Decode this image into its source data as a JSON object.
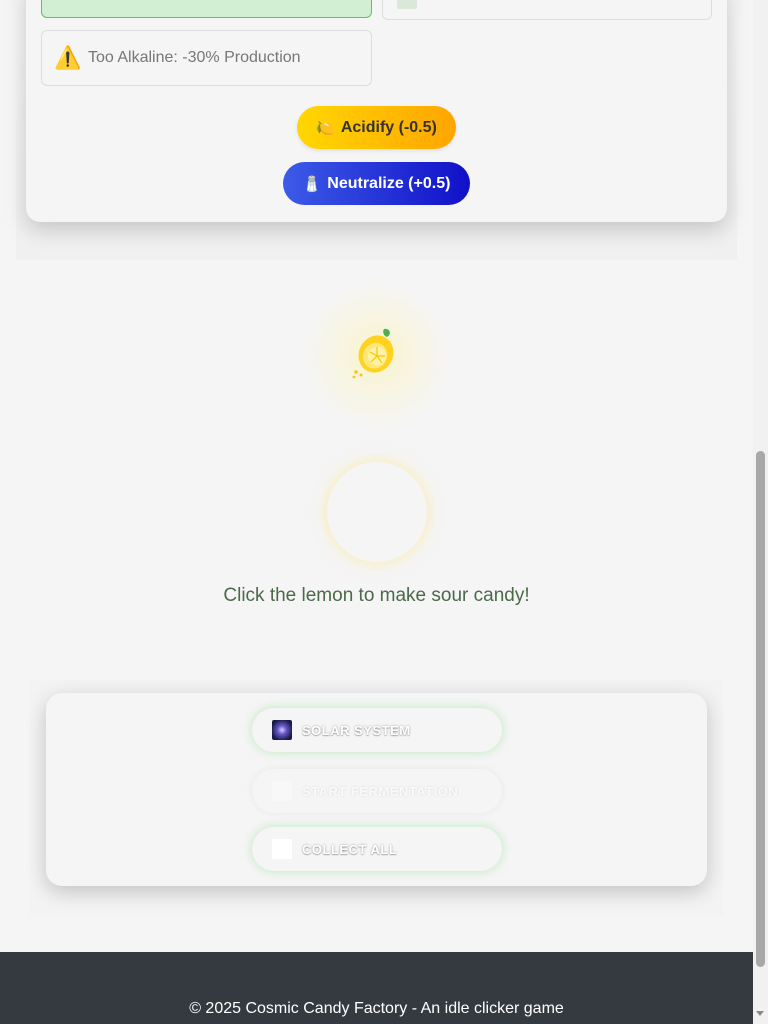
{
  "ph_panel": {
    "warning_icon": "warning-icon",
    "warning_text": "Too Alkaline: -30% Production",
    "acidify_button": {
      "icon": "🍋",
      "label": "Acidify (-0.5)"
    },
    "neutralize_button": {
      "icon": "🧂",
      "label": "Neutralize (+0.5)"
    }
  },
  "clicker": {
    "hint": "Click the lemon to make sour candy!"
  },
  "actions": {
    "solar_system": {
      "icon": "galaxy-icon",
      "label": "SOLAR SYSTEM"
    },
    "start_fermentation": {
      "icon": "ferment-icon",
      "label": "START FERMENTATION"
    },
    "collect_all": {
      "icon": "collect-icon",
      "label": "COLLECT ALL"
    }
  },
  "footer": {
    "text": "© 2025 Cosmic Candy Factory - An idle clicker game"
  },
  "colors": {
    "acidify_gradient_start": "#ffd700",
    "acidify_gradient_end": "#ffa500",
    "neutralize_gradient_start": "#3d5be8",
    "neutralize_gradient_end": "#1010c8",
    "active_box": "#d3efd3",
    "footer_bg": "#343a40"
  }
}
